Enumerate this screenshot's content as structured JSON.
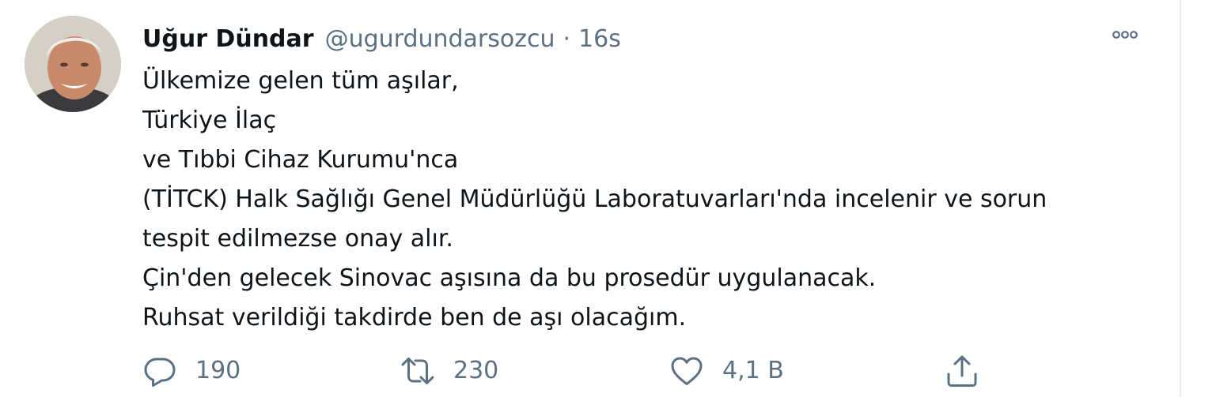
{
  "tweet": {
    "author": {
      "name": "Uğur Dündar",
      "handle": "@ugurdundarsozcu"
    },
    "separator": "·",
    "timestamp": "16s",
    "lines": [
      "Ülkemize gelen tüm aşılar,",
      "Türkiye İlaç",
      "ve Tıbbi Cihaz Kurumu'nca",
      "(TİTCK) Halk Sağlığı Genel Müdürlüğü Laboratuvarları'nda incelenir ve sorun",
      "tespit edilmezse onay alır.",
      "Çin'den gelecek Sinovac aşısına da bu prosedür uygulanacak.",
      "Ruhsat verildiği takdirde ben de aşı olacağım."
    ],
    "actions": {
      "reply_count": "190",
      "retweet_count": "230",
      "like_count": "4,1 B"
    }
  },
  "icons": {
    "reply": "comment-bubble-icon",
    "retweet": "retweet-arrows-icon",
    "like": "heart-outline-icon",
    "share": "share-upload-icon",
    "more": "more-horizontal-icon"
  },
  "colors": {
    "text_primary": "#0f1419",
    "text_secondary": "#5b7083",
    "divider": "#ebeef0"
  }
}
